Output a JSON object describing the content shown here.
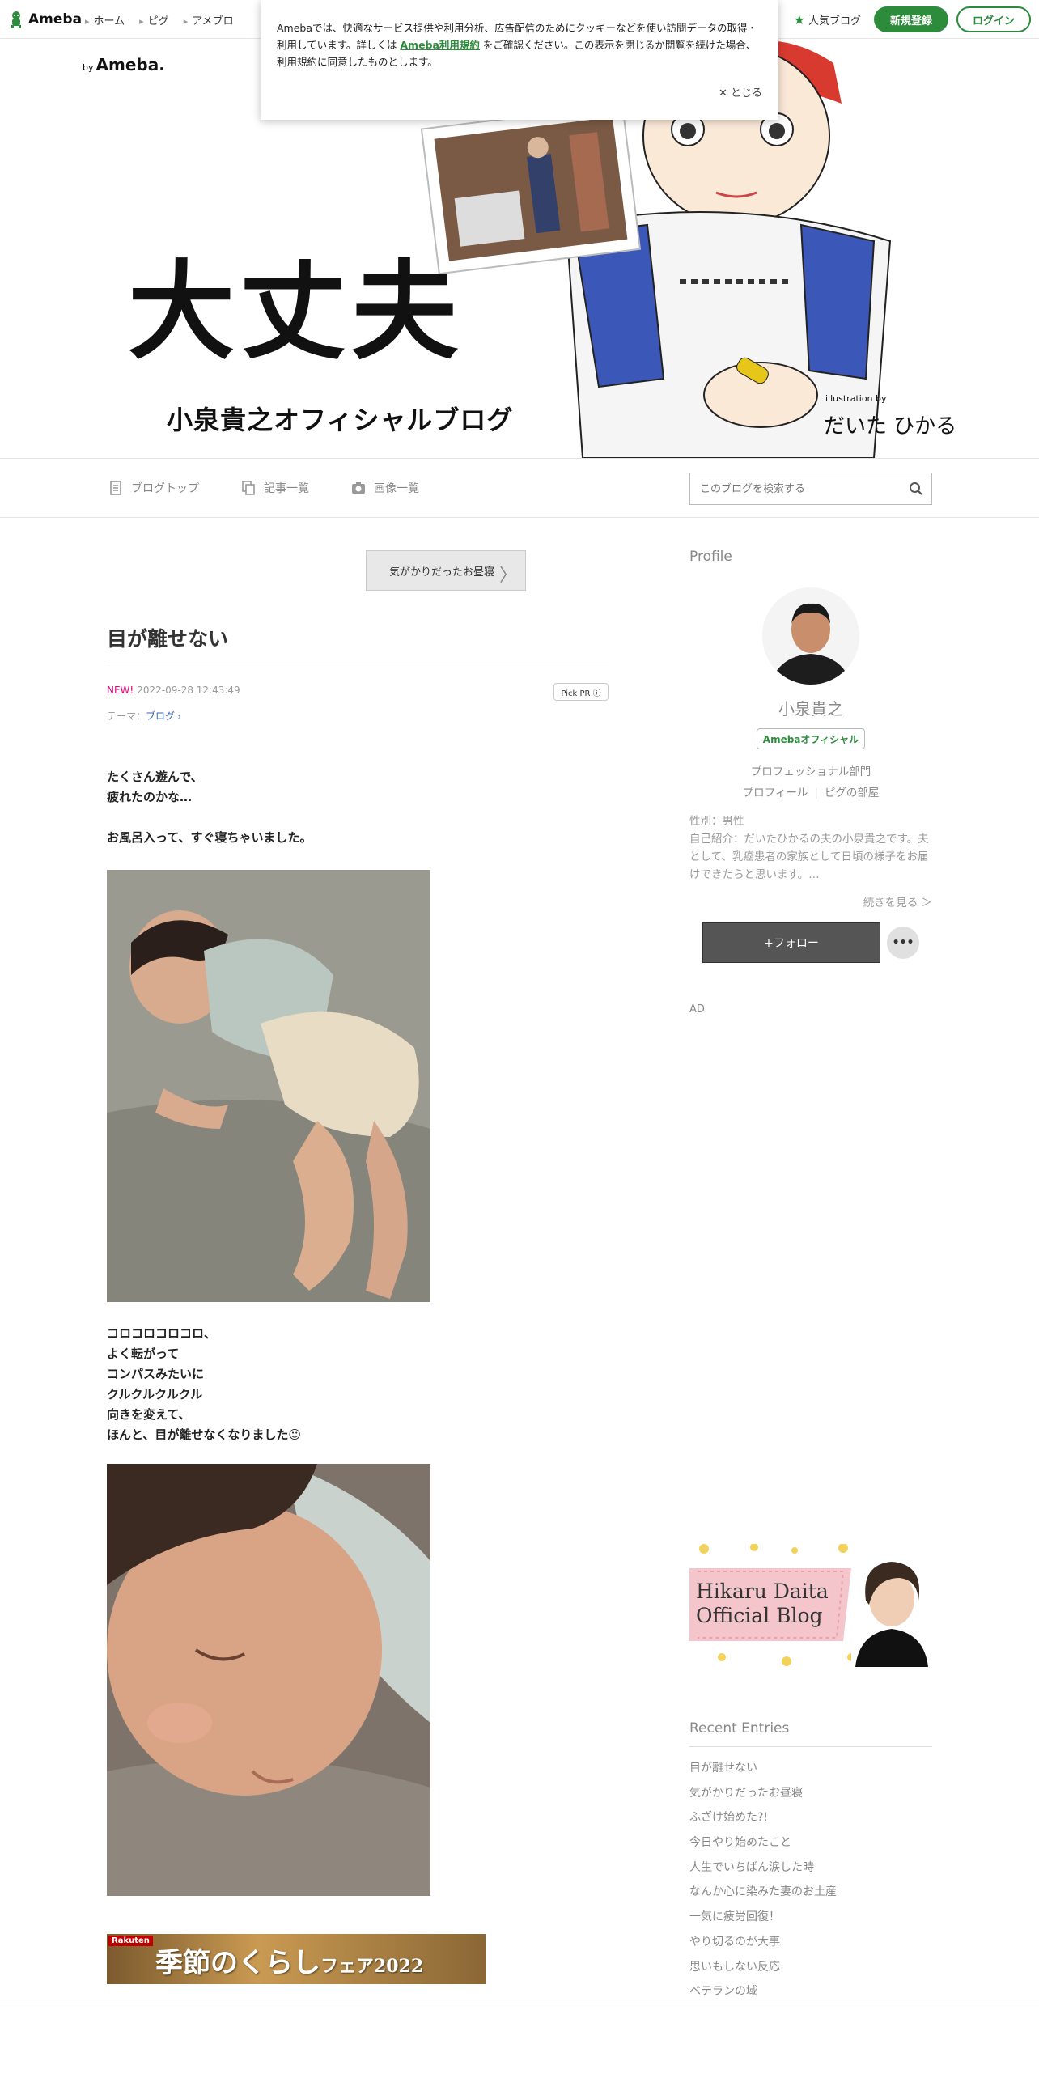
{
  "gnav": {
    "logo": "Ameba",
    "links": [
      "ホーム",
      "ピグ",
      "アメブロ"
    ],
    "popular": "人気ブログ",
    "register": "新規登録",
    "login": "ログイン"
  },
  "cookie": {
    "text_before": "Amebaでは、快適なサービス提供や利用分析、広告配信のためにクッキーなどを使い訪問データの取得・利用しています。詳しくは",
    "link": "Ameba利用規約",
    "text_after": "をご確認ください。この表示を閉じるか閲覧を続けた場合、利用規約に同意したものとします。",
    "close": "とじる"
  },
  "header": {
    "by_small": "by",
    "by_brand": "Ameba.",
    "title": "大丈夫",
    "subtitle": "小泉貴之オフィシャルブログ",
    "illus_by": "illustration by",
    "illus_sig": "だいた ひかる"
  },
  "blognav": {
    "items": [
      "ブログトップ",
      "記事一覧",
      "画像一覧"
    ],
    "search_placeholder": "このブログを検索する"
  },
  "post": {
    "prev_label": "気がかりだったお昼寝",
    "title": "目が離せない",
    "new_label": "NEW!",
    "date": "2022-09-28 12:43:49",
    "pickpr": "Pick PR ⓘ",
    "theme_label": "テーマ：",
    "theme": "ブログ",
    "para1": [
      "たくさん遊んで、",
      "疲れたのかな…",
      "",
      "お風呂入って、すぐ寝ちゃいました。"
    ],
    "para2": [
      "コロコロコロコロ、",
      "よく転がって",
      "コンパスみたいに",
      "クルクルクルクル",
      "向きを変えて、",
      "ほんと、目が離せなくなりました☺"
    ],
    "ad_brand": "Rakuten",
    "ad_main": "季節のくらし",
    "ad_sub": "フェア2022"
  },
  "sidebar": {
    "profile_head": "Profile",
    "name": "小泉貴之",
    "official": "Amebaオフィシャル",
    "category": "プロフェッショナル部門",
    "link1": "プロフィール",
    "link2": "ピグの部屋",
    "gender": "性別：男性",
    "intro": "自己紹介：だいたひかるの夫の小泉貴之です。夫として、乳癌患者の家族として日頃の様子をお届けできたらと思います。…",
    "more": "続きを見る ＞",
    "follow": "+フォロー",
    "dots": "•••",
    "ad": "AD",
    "banner_line1": "Hikaru Daita",
    "banner_line2": "Official Blog",
    "recent_head": "Recent Entries",
    "recent": [
      "目が離せない",
      "気がかりだったお昼寝",
      "ふざけ始めた?!",
      "今日やり始めたこと",
      "人生でいちばん涙した時",
      "なんか心に染みた妻のお土産",
      "一気に疲労回復！",
      "やり切るのが大事",
      "思いもしない反応",
      "ベテランの域"
    ]
  },
  "colors": {
    "brand_green": "#2d8c3c",
    "new_pink": "#e4007f",
    "follow_bg": "#555555"
  },
  "icons": [
    "ameba-logo-icon",
    "star-icon",
    "close-icon",
    "document-icon",
    "copy-icon",
    "camera-icon",
    "search-icon",
    "chevron-right-icon"
  ]
}
